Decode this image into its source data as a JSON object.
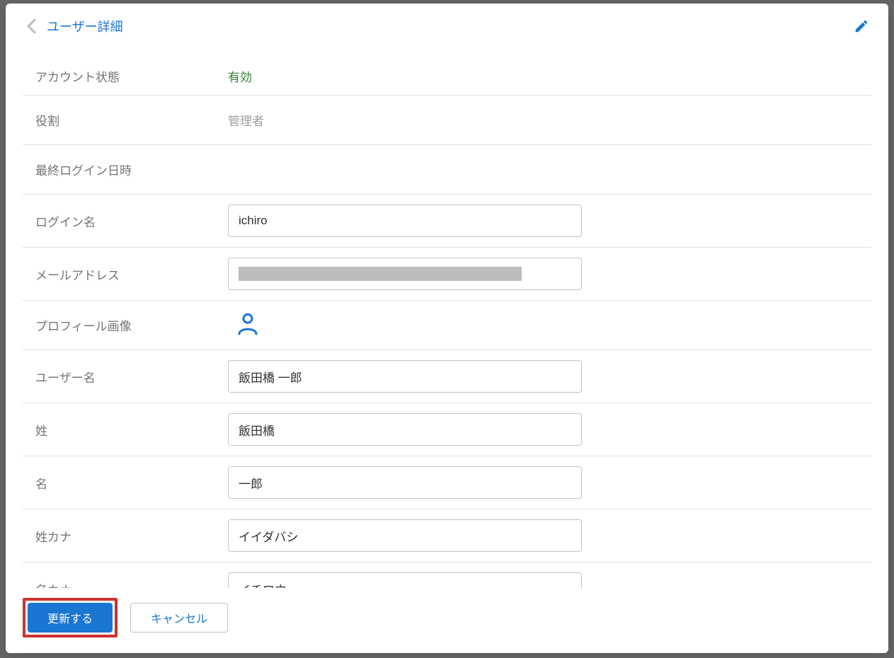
{
  "header": {
    "title": "ユーザー詳細"
  },
  "fields": {
    "account_status": {
      "label": "アカウント状態",
      "value": "有効"
    },
    "role": {
      "label": "役割",
      "value": "管理者"
    },
    "last_login": {
      "label": "最終ログイン日時",
      "value": ""
    },
    "login_name": {
      "label": "ログイン名",
      "value": "ichiro"
    },
    "email": {
      "label": "メールアドレス",
      "value": ""
    },
    "profile_image": {
      "label": "プロフィール画像"
    },
    "user_name": {
      "label": "ユーザー名",
      "value": "飯田橋 一郎"
    },
    "last_name": {
      "label": "姓",
      "value": "飯田橋"
    },
    "first_name": {
      "label": "名",
      "value": "一郎"
    },
    "last_name_kana": {
      "label": "姓カナ",
      "value": "イイダバシ"
    },
    "first_name_kana": {
      "label": "名カナ",
      "value": "イチロウ"
    }
  },
  "footer": {
    "update": "更新する",
    "cancel": "キャンセル"
  }
}
